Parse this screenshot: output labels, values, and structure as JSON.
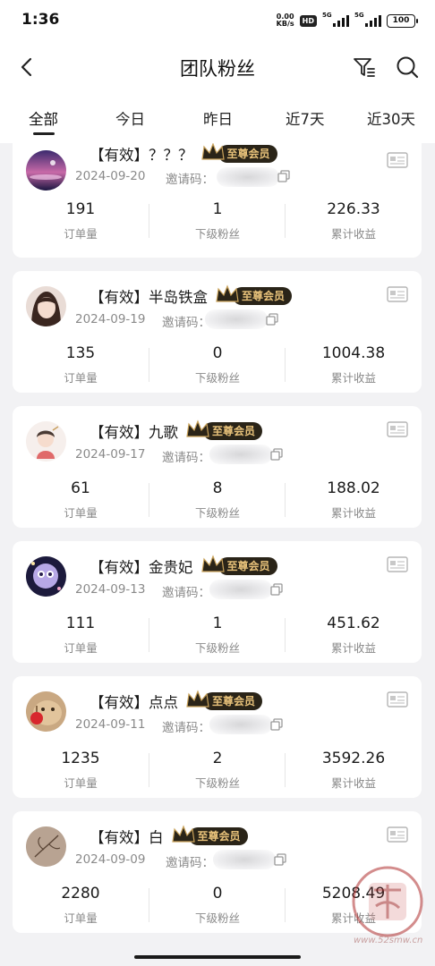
{
  "status_bar": {
    "time": "1:36",
    "net_speed_value": "0.00",
    "net_speed_unit": "KB/s",
    "hd": "HD",
    "signal_label": "5G",
    "battery": "100"
  },
  "header": {
    "title": "团队粉丝",
    "back_icon": "chevron-left-icon",
    "filter_icon": "filter-icon",
    "search_icon": "search-icon"
  },
  "tabs": [
    {
      "label": "全部",
      "active": true
    },
    {
      "label": "今日",
      "active": false
    },
    {
      "label": "昨日",
      "active": false
    },
    {
      "label": "近7天",
      "active": false
    },
    {
      "label": "近30天",
      "active": false
    }
  ],
  "labels": {
    "invite": "邀请码：",
    "orders": "订单量",
    "sub_fans": "下级粉丝",
    "earnings": "累计收益",
    "vip": "至尊会员"
  },
  "fans": [
    {
      "name": "【有效】？？？",
      "date": "2024-09-20",
      "orders": "191",
      "sub_fans": "1",
      "earnings": "226.33"
    },
    {
      "name": "【有效】半岛铁盒",
      "date": "2024-09-19",
      "orders": "135",
      "sub_fans": "0",
      "earnings": "1004.38"
    },
    {
      "name": "【有效】九歌",
      "date": "2024-09-17",
      "orders": "61",
      "sub_fans": "8",
      "earnings": "188.02"
    },
    {
      "name": "【有效】金贵妃",
      "date": "2024-09-13",
      "orders": "111",
      "sub_fans": "1",
      "earnings": "451.62"
    },
    {
      "name": "【有效】点点",
      "date": "2024-09-11",
      "orders": "1235",
      "sub_fans": "2",
      "earnings": "3592.26"
    },
    {
      "name": "【有效】白",
      "date": "2024-09-09",
      "orders": "2280",
      "sub_fans": "0",
      "earnings": "5208.49"
    }
  ],
  "watermark": {
    "url": "www.52smw.cn"
  },
  "colors": {
    "vip_text": "#e8c27a",
    "vip_bg": "#2a2418",
    "background": "#f2f2f4"
  }
}
